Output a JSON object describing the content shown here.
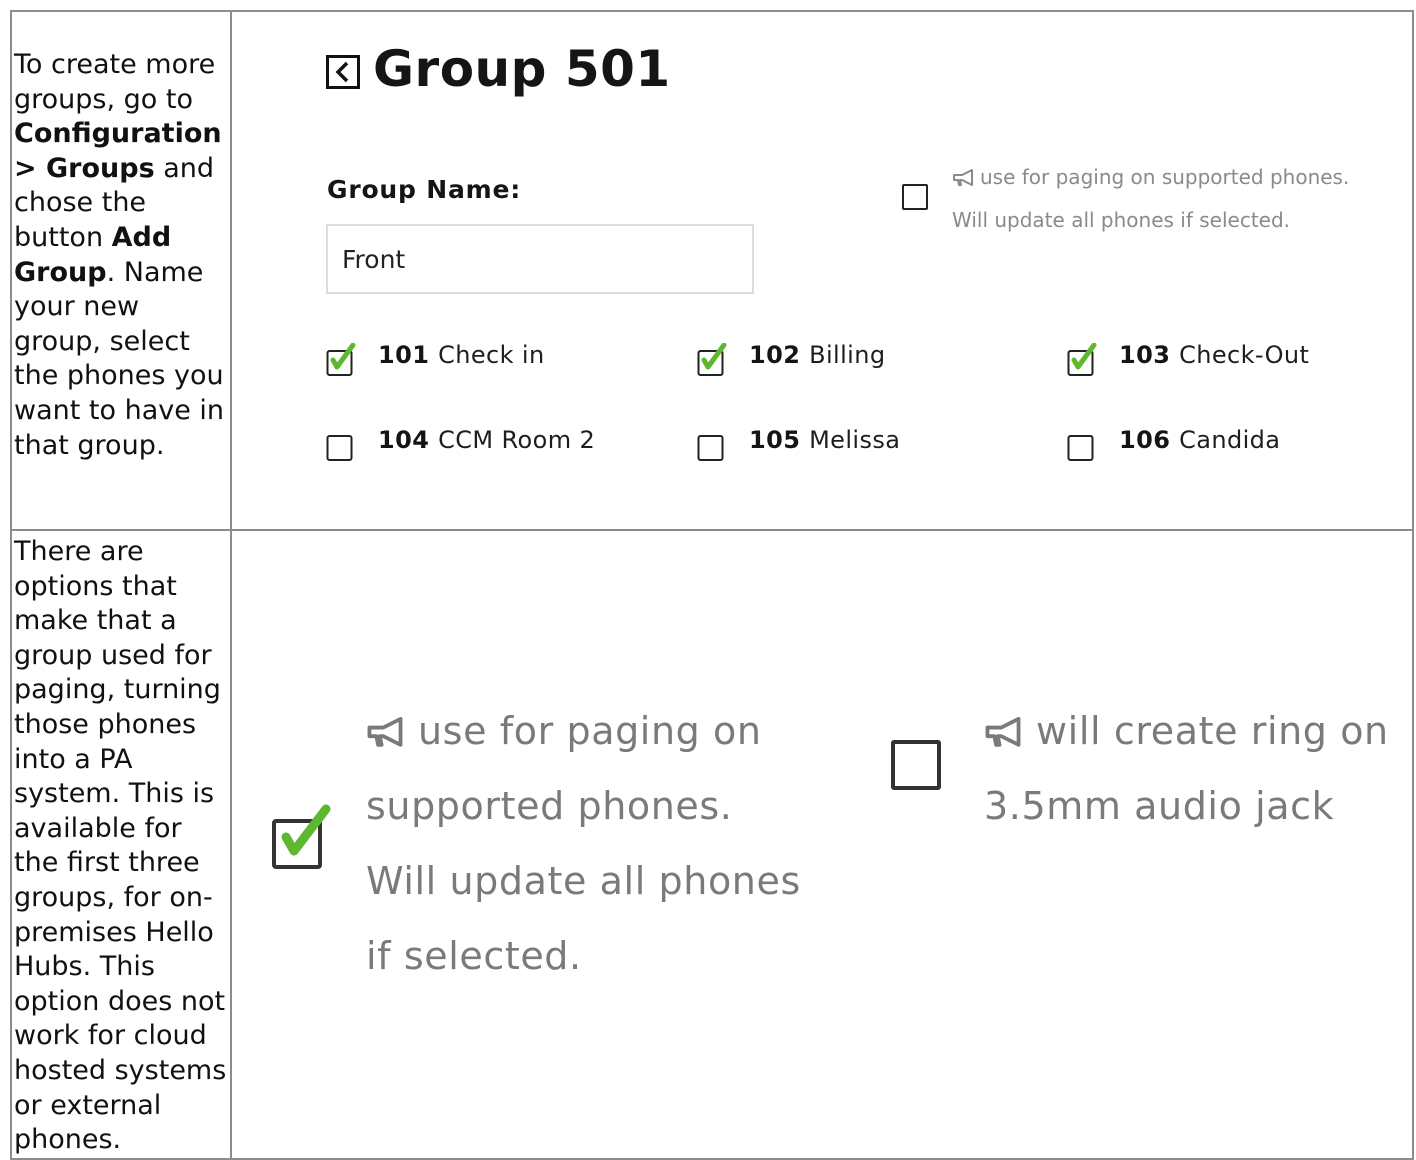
{
  "row1": {
    "instructions": {
      "t1": "To create more groups, go to ",
      "b1": "Configuration > Groups",
      "t2": " and chose the button ",
      "b2": "Add Group",
      "t3": ". Name your new group, select the phones you want to have in that group."
    },
    "screenshot": {
      "title": "Group 501",
      "group_name_label": "Group Name:",
      "group_name_value": "Front",
      "paging_option": {
        "line1": "use for paging on supported phones.",
        "line2": "Will update all phones if selected.",
        "checked": false
      },
      "phones": [
        {
          "ext": "101",
          "name": "Check in",
          "checked": true
        },
        {
          "ext": "102",
          "name": "Billing",
          "checked": true
        },
        {
          "ext": "103",
          "name": "Check-Out",
          "checked": true
        },
        {
          "ext": "104",
          "name": "CCM Room 2",
          "checked": false
        },
        {
          "ext": "105",
          "name": "Melissa",
          "checked": false
        },
        {
          "ext": "106",
          "name": "Candida",
          "checked": false
        }
      ]
    }
  },
  "row2": {
    "instructions": "There are options that make that a group used for paging, turning those phones into a PA system. This is available for the first three groups, for on-premises Hello Hubs. This option does not work for cloud hosted systems or external phones.",
    "screenshot": {
      "paging_option": {
        "lines": [
          "use for paging on",
          "supported phones.",
          "Will update all phones",
          "if selected."
        ],
        "checked": true
      },
      "ring_option": {
        "lines": [
          "will create ring on",
          "3.5mm audio jack"
        ],
        "checked": false
      }
    }
  },
  "colors": {
    "check_green": "#5cb82e",
    "hint_gray": "#8a8a8a",
    "border_gray": "#8c8c8c"
  }
}
